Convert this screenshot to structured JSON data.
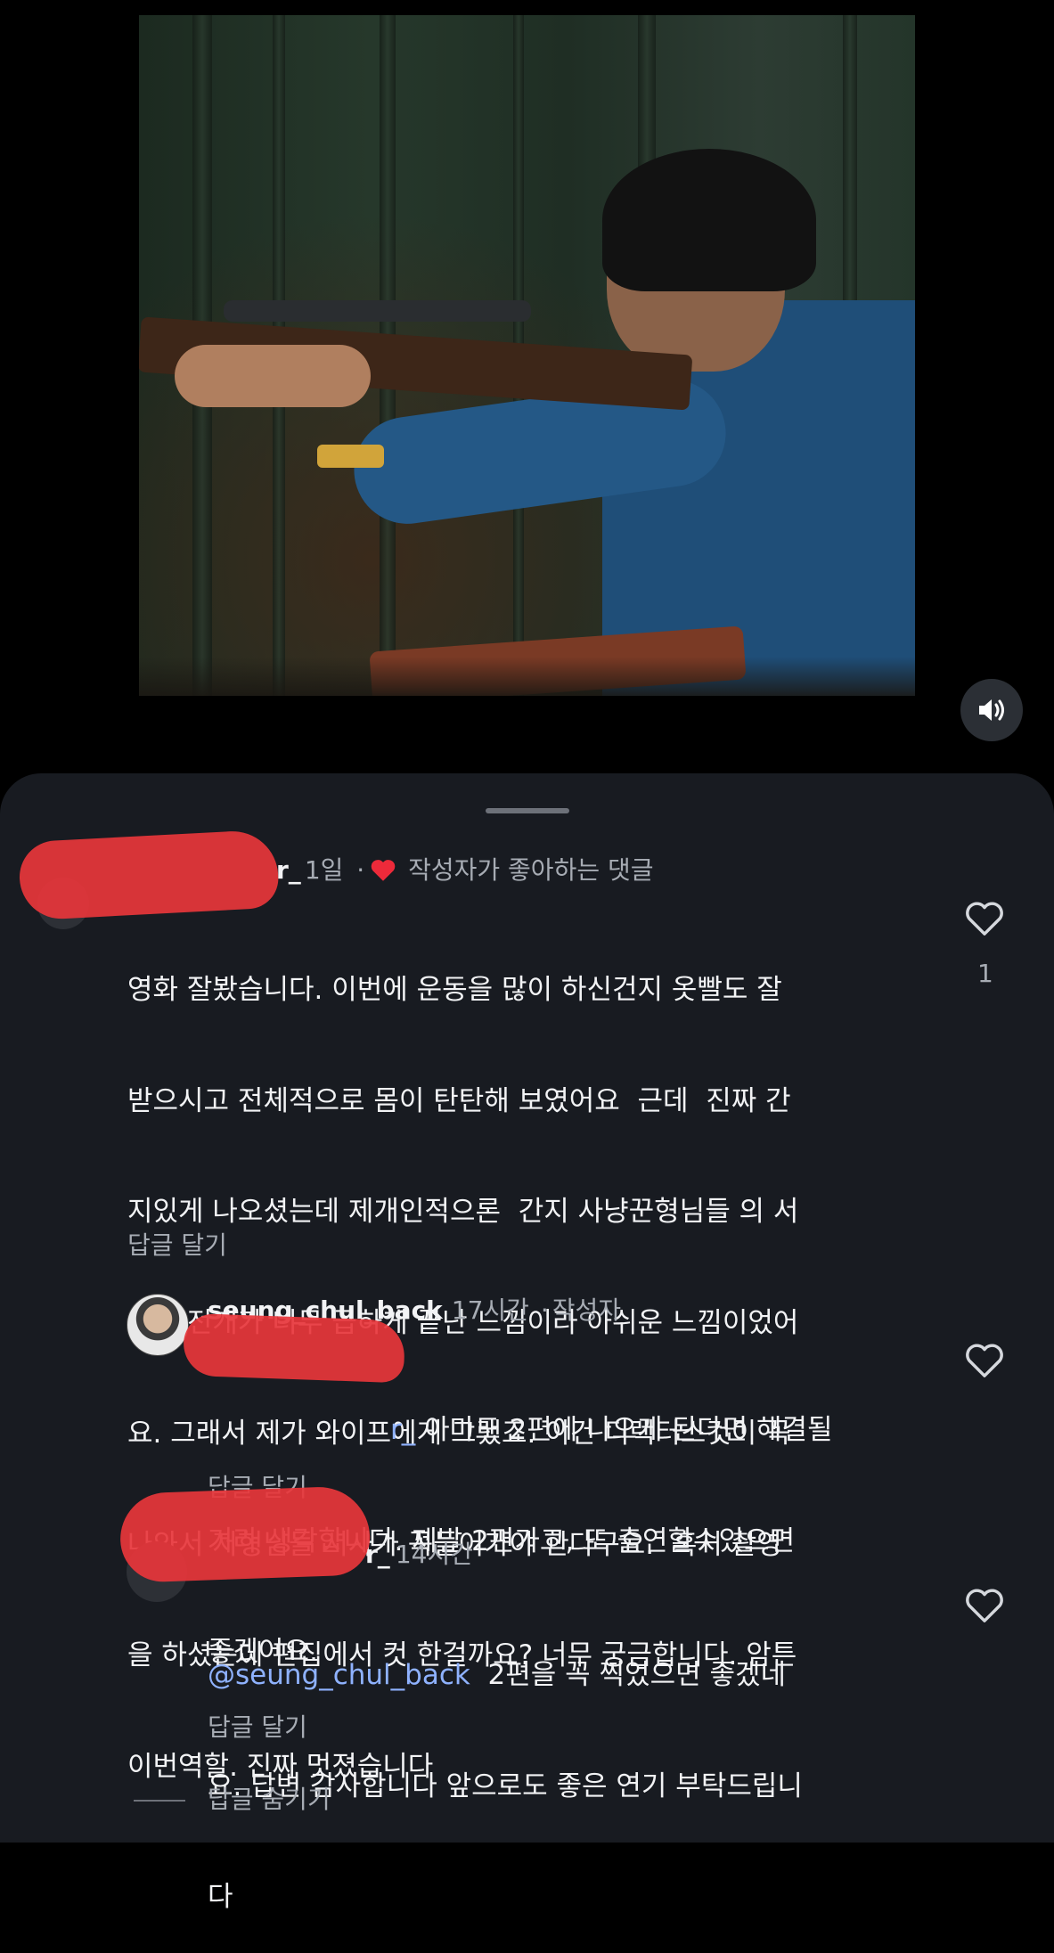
{
  "comments": [
    {
      "username_suffix": "r_",
      "time": "1일",
      "separator": "·",
      "badge": "작성자가 좋아하는 댓글",
      "lines": [
        "영화 잘봤습니다. 이번에 운동을 많이 하신건지 옷빨도 잘",
        "받으시고 전체적으로 몸이 탄탄해 보였어요  근데  진짜 간",
        "지있게 나오셨는데 제개인적으론  간지 사냥꾼형님들 의 서",
        "사나 전개가 너무 급하게 끝난 느낌이라 아쉬운 느낌이었어",
        "요. 그래서 제가 와이프에게 그랬죠. 이건 디렉터스컷이 꼭",
        "나와서 저형님들 서사가 꼭들어가야 한다구요.  혹시 촬영",
        "을 하셨는데 편집에서 컷 한걸까요? 너무 궁금합니다. 암튼",
        "이번역할. 진짜 멋졌습니다"
      ],
      "reply_label": "답글 달기",
      "like_count": "1"
    },
    {
      "username": "seung_chul_back",
      "time": "17시간",
      "separator": "·",
      "role": "작성자",
      "mention_suffix": "r_",
      "text_first": " 아마도 2편에 나오게 된다면 해결될",
      "lines": [
        "거라 생각합니다. 제발 2편가고, 또 출연할수있으면",
        "좋겠어요."
      ],
      "reply_label": "답글 달기"
    },
    {
      "username_suffix": "r_",
      "time": "14시간",
      "mention": "@seung_chul_back",
      "text_first": "  2편을 꼭 찍었으면 좋겠네",
      "lines": [
        "요. 답변 감사합니다 앞으로도 좋은 연기 부탁드립니",
        "다"
      ],
      "reply_label": "답글 달기"
    }
  ],
  "hide_replies_label": "답글 숨기기",
  "icons": {
    "heart_filled_color": "#ed2a3a",
    "mute_icon": "speaker-icon"
  }
}
